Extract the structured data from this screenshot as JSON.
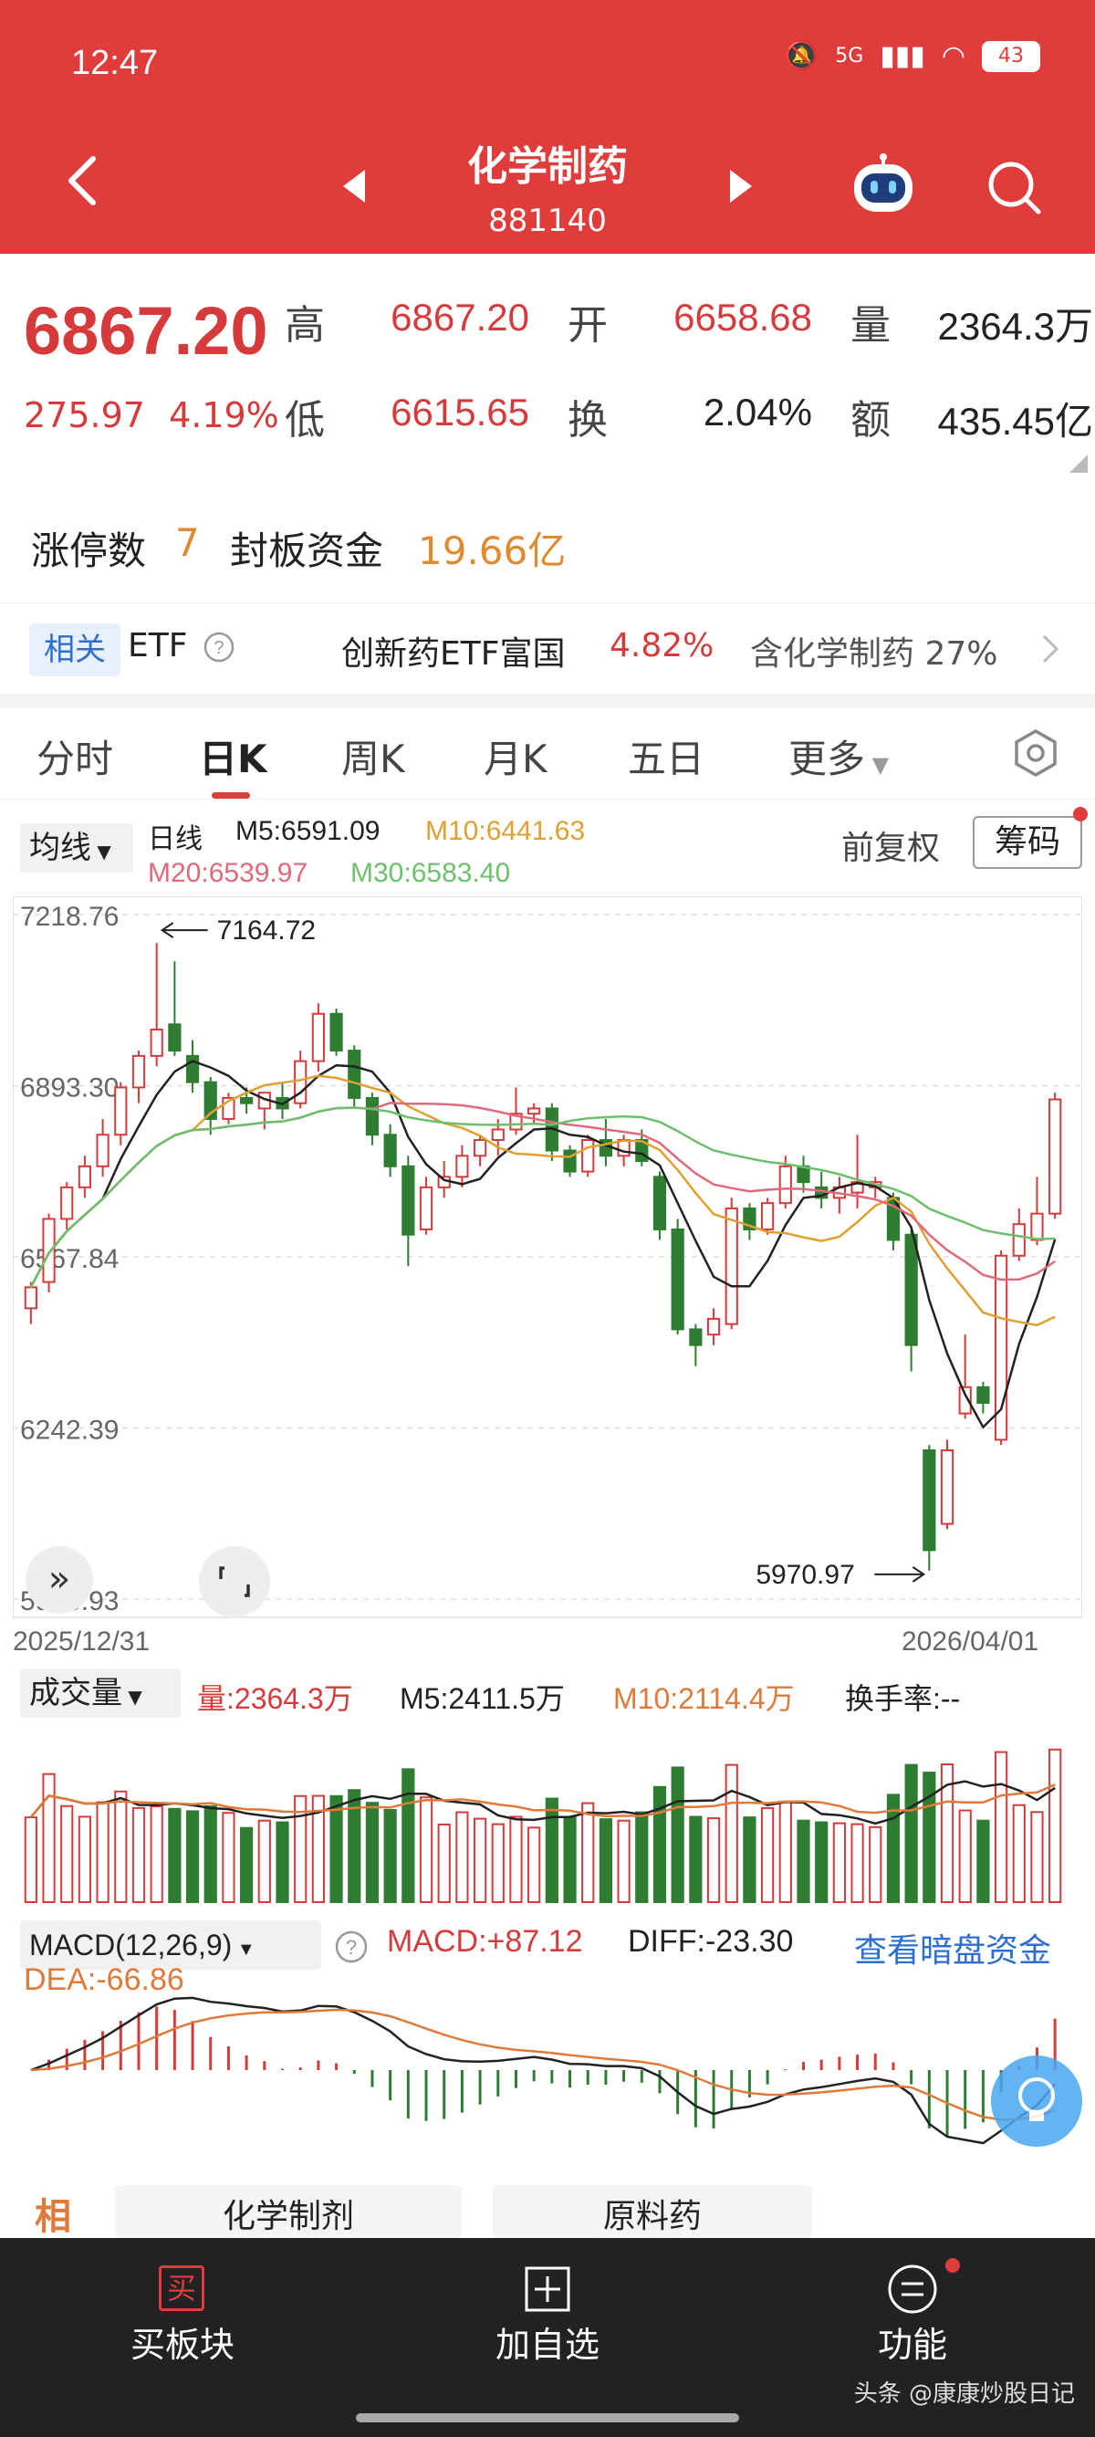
{
  "status": {
    "time": "12:47",
    "network": "5G",
    "battery": "43"
  },
  "header": {
    "title": "化学制药",
    "code": "881140"
  },
  "quote": {
    "price": "6867.20",
    "change": "275.97",
    "change_pct": "4.19%",
    "high_label": "高",
    "high": "6867.20",
    "open_label": "开",
    "open": "6658.68",
    "volume_label": "量",
    "volume": "2364.3万",
    "low_label": "低",
    "low": "6615.65",
    "turnover_label": "换",
    "turnover": "2.04%",
    "amount_label": "额",
    "amount": "435.45亿"
  },
  "limit": {
    "count_label": "涨停数",
    "count": "7",
    "fund_label": "封板资金",
    "fund": "19.66亿"
  },
  "etf": {
    "tag": "相关",
    "label": "ETF",
    "name": "创新药ETF富国",
    "pct": "4.82%",
    "contain": "含化学制药 27%"
  },
  "tabs": [
    "分时",
    "日K",
    "周K",
    "月K",
    "五日",
    "更多"
  ],
  "ma": {
    "selector": "均线",
    "period": "日线",
    "m5": "M5:6591.09",
    "m10": "M10:6441.63",
    "m20": "M20:6539.97",
    "m30": "M30:6583.40",
    "adjust": "前复权",
    "chips": "筹码"
  },
  "colors": {
    "up": "#d63a3a",
    "down": "#2e7d32",
    "m5": "#222222",
    "m10": "#e0a030",
    "m20": "#e06a7a",
    "m30": "#6cc06c"
  },
  "chart_data": {
    "type": "candlestick",
    "y_labels": [
      "7218.76",
      "6893.30",
      "6567.84",
      "6242.39",
      "5916.93"
    ],
    "ylim": [
      5916.93,
      7218.76
    ],
    "date_start": "2025/12/31",
    "date_end": "2026/04/01",
    "high_annotation": "7164.72",
    "low_annotation": "5970.97",
    "ohlc": [
      [
        6470,
        6520,
        6440,
        6510
      ],
      [
        6520,
        6650,
        6500,
        6640
      ],
      [
        6640,
        6710,
        6620,
        6700
      ],
      [
        6700,
        6760,
        6680,
        6740
      ],
      [
        6740,
        6830,
        6720,
        6800
      ],
      [
        6800,
        6900,
        6780,
        6890
      ],
      [
        6890,
        6960,
        6860,
        6950
      ],
      [
        6950,
        7164.72,
        6930,
        7000
      ],
      [
        7010,
        7130,
        6950,
        6960
      ],
      [
        6950,
        6980,
        6880,
        6900
      ],
      [
        6900,
        6910,
        6800,
        6830
      ],
      [
        6830,
        6880,
        6820,
        6870
      ],
      [
        6870,
        6890,
        6840,
        6860
      ],
      [
        6850,
        6880,
        6810,
        6880
      ],
      [
        6870,
        6900,
        6830,
        6850
      ],
      [
        6860,
        6960,
        6850,
        6940
      ],
      [
        6940,
        7050,
        6920,
        7030
      ],
      [
        7030,
        7040,
        6950,
        6960
      ],
      [
        6960,
        6970,
        6850,
        6870
      ],
      [
        6870,
        6880,
        6780,
        6800
      ],
      [
        6800,
        6820,
        6720,
        6740
      ],
      [
        6740,
        6760,
        6550,
        6610
      ],
      [
        6620,
        6720,
        6610,
        6700
      ],
      [
        6700,
        6750,
        6680,
        6720
      ],
      [
        6720,
        6780,
        6700,
        6760
      ],
      [
        6760,
        6800,
        6740,
        6790
      ],
      [
        6790,
        6830,
        6760,
        6810
      ],
      [
        6810,
        6890,
        6800,
        6840
      ],
      [
        6840,
        6860,
        6820,
        6850
      ],
      [
        6850,
        6860,
        6750,
        6770
      ],
      [
        6770,
        6780,
        6720,
        6730
      ],
      [
        6730,
        6800,
        6720,
        6790
      ],
      [
        6790,
        6830,
        6740,
        6760
      ],
      [
        6760,
        6800,
        6740,
        6790
      ],
      [
        6790,
        6810,
        6740,
        6750
      ],
      [
        6720,
        6730,
        6600,
        6620
      ],
      [
        6620,
        6640,
        6420,
        6430
      ],
      [
        6430,
        6440,
        6360,
        6400
      ],
      [
        6420,
        6470,
        6400,
        6450
      ],
      [
        6440,
        6680,
        6430,
        6660
      ],
      [
        6660,
        6670,
        6600,
        6620
      ],
      [
        6620,
        6680,
        6610,
        6670
      ],
      [
        6670,
        6760,
        6660,
        6740
      ],
      [
        6740,
        6760,
        6690,
        6710
      ],
      [
        6700,
        6730,
        6660,
        6680
      ],
      [
        6680,
        6720,
        6650,
        6700
      ],
      [
        6690,
        6800,
        6660,
        6710
      ],
      [
        6700,
        6720,
        6680,
        6710
      ],
      [
        6680,
        6690,
        6580,
        6600
      ],
      [
        6610,
        6620,
        6350,
        6400
      ],
      [
        6200,
        6210,
        5970.97,
        6010
      ],
      [
        6060,
        6220,
        6050,
        6200
      ],
      [
        6270,
        6420,
        6260,
        6320
      ],
      [
        6320,
        6330,
        6270,
        6290
      ],
      [
        6220,
        6580,
        6210,
        6570
      ],
      [
        6570,
        6660,
        6560,
        6630
      ],
      [
        6600,
        6720,
        6590,
        6650
      ],
      [
        6650,
        6880,
        6640,
        6867.2
      ]
    ]
  },
  "volume": {
    "selector": "成交量",
    "vol": "量:2364.3万",
    "m5": "M5:2411.5万",
    "m10": "M10:2114.4万",
    "turnover": "换手率:--"
  },
  "macd": {
    "selector": "MACD(12,26,9)",
    "macd": "MACD:+87.12",
    "diff": "DIFF:-23.30",
    "link": "查看暗盘资金",
    "dea": "DEA:-66.86"
  },
  "related": {
    "tag": "相",
    "item1": "化学制剂",
    "item2": "原料药"
  },
  "bottom_nav": {
    "buy": "买板块",
    "buy_icon_text": "买",
    "add": "加自选",
    "func": "功能"
  },
  "watermark": "头条 @康康炒股日记"
}
